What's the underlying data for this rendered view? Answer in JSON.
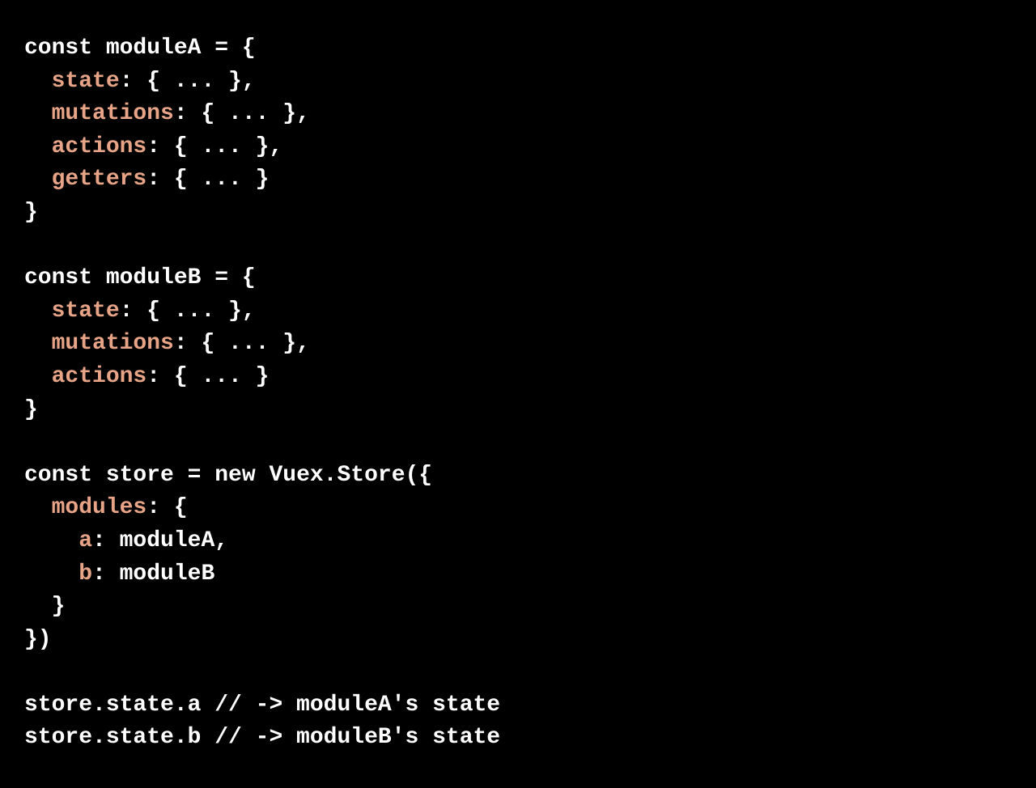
{
  "code": {
    "line1_const": "const",
    "line1_rest": " moduleA = {",
    "line2_prop": "  state",
    "line2_rest": ": { ... },",
    "line3_prop": "  mutations",
    "line3_rest": ": { ... },",
    "line4_prop": "  actions",
    "line4_rest": ": { ... },",
    "line5_prop": "  getters",
    "line5_rest": ": { ... }",
    "line6": "}",
    "line7": "",
    "line8_const": "const",
    "line8_rest": " moduleB = {",
    "line9_prop": "  state",
    "line9_rest": ": { ... },",
    "line10_prop": "  mutations",
    "line10_rest": ": { ... },",
    "line11_prop": "  actions",
    "line11_rest": ": { ... }",
    "line12": "}",
    "line13": "",
    "line14_const": "const",
    "line14_rest": " store = ",
    "line14_new": "new",
    "line14_rest2": " Vuex.Store({",
    "line15_prop": "  modules",
    "line15_rest": ": {",
    "line16_prop": "    a",
    "line16_rest": ": moduleA,",
    "line17_prop": "    b",
    "line17_rest": ": moduleB",
    "line18": "  }",
    "line19": "})",
    "line20": "",
    "line21": "store.state.a // -> moduleA's state",
    "line22": "store.state.b // -> moduleB's state"
  }
}
